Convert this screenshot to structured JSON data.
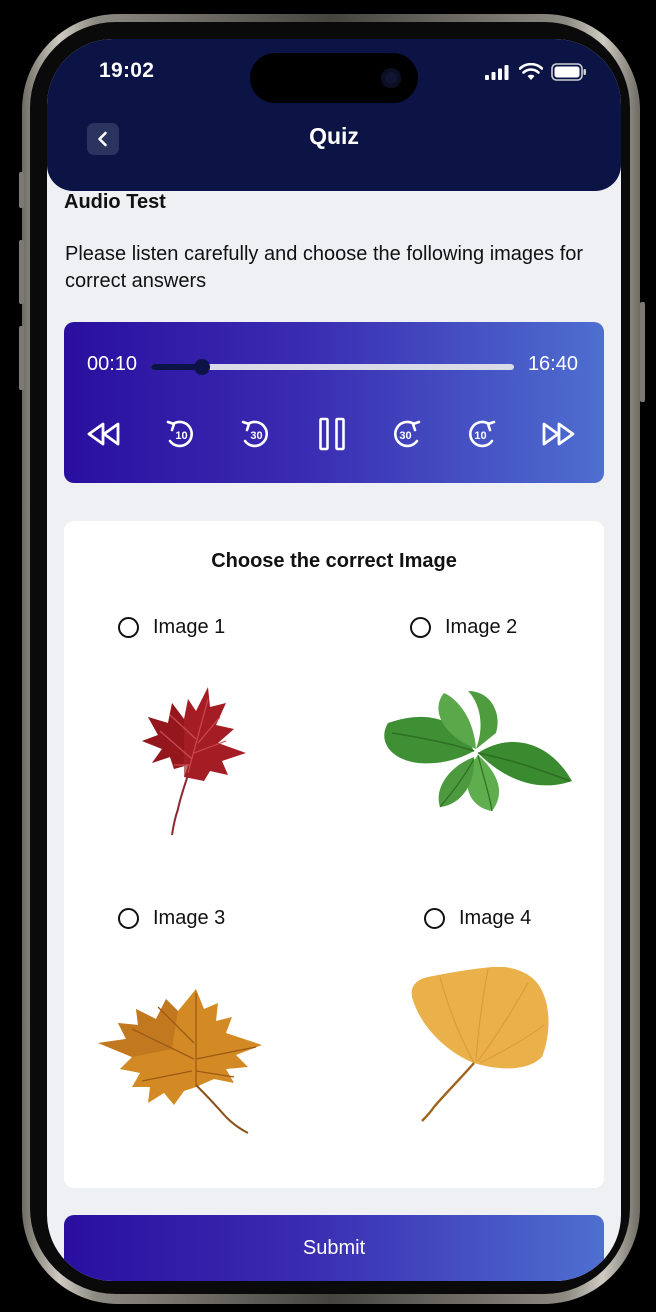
{
  "status_bar": {
    "time": "19:02"
  },
  "header": {
    "title": "Quiz"
  },
  "section": {
    "title": "Audio Test",
    "instructions": "Please listen carefully and choose the following images for correct answers"
  },
  "player": {
    "current_time": "00:10",
    "total_time": "16:40",
    "progress": 0.14,
    "skip_back_label": "10",
    "skip_back_long_label": "30",
    "skip_fwd_long_label": "30",
    "skip_fwd_label": "10",
    "accent": "#0b1445"
  },
  "question": {
    "title": "Choose the correct Image",
    "options": [
      {
        "label": "Image 1",
        "image": "red-maple-leaf"
      },
      {
        "label": "Image 2",
        "image": "basil-leaves"
      },
      {
        "label": "Image 3",
        "image": "orange-maple-leaf"
      },
      {
        "label": "Image 4",
        "image": "ginkgo-leaf"
      }
    ]
  },
  "submit": {
    "label": "Submit"
  },
  "colors": {
    "header_bg": "#0b1445",
    "gradient_start": "#2a0f9f",
    "gradient_end": "#4e6fd0",
    "background": "#eef0f3"
  }
}
